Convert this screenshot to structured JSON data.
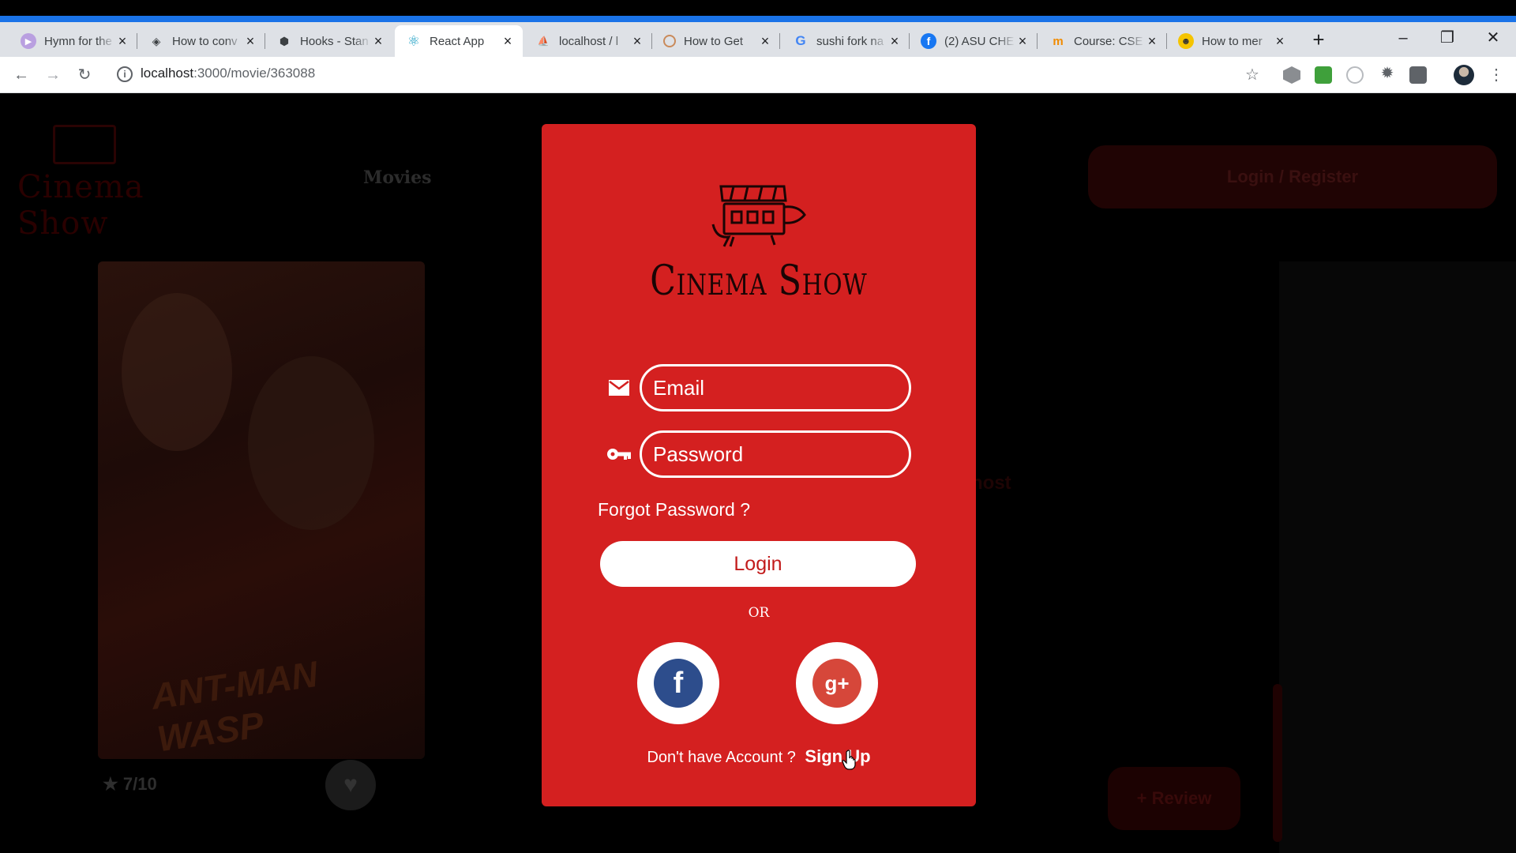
{
  "browser": {
    "tabs": [
      {
        "title": "Hymn for the",
        "icon": "music-icon",
        "active": false
      },
      {
        "title": "How to conv",
        "icon": "diamond-icon",
        "active": false
      },
      {
        "title": "Hooks - Stan",
        "icon": "cube-icon",
        "active": false
      },
      {
        "title": "React App",
        "icon": "react-icon",
        "active": true
      },
      {
        "title": "localhost / l",
        "icon": "phpmyadmin-icon",
        "active": false
      },
      {
        "title": "How to Get",
        "icon": "circle-icon",
        "active": false
      },
      {
        "title": "sushi fork na",
        "icon": "google-icon",
        "active": false
      },
      {
        "title": "(2) ASU CHE",
        "icon": "facebook-icon",
        "active": false
      },
      {
        "title": "Course: CSE",
        "icon": "moodle-icon",
        "active": false
      },
      {
        "title": "How to mer",
        "icon": "avatar-icon",
        "active": false
      }
    ],
    "url_host": "localhost",
    "url_path": ":3000/movie/363088",
    "accent_color": "#1a73e8"
  },
  "page": {
    "brand": "Cinema Show",
    "nav_movies": "Movies",
    "login_register": "Login / Register",
    "rating": "7/10",
    "review_button": "Review"
  },
  "modal": {
    "brand": "Cinema Show",
    "email_placeholder": "Email",
    "password_placeholder": "Password",
    "forgot_password": "Forgot Password ?",
    "login_button": "Login",
    "or_text": "OR",
    "no_account": "Don't have Account ?",
    "signup_link": "Sign Up",
    "background_color": "#d42020",
    "facebook_color": "#2d4d8c",
    "google_color": "#d6473a"
  }
}
